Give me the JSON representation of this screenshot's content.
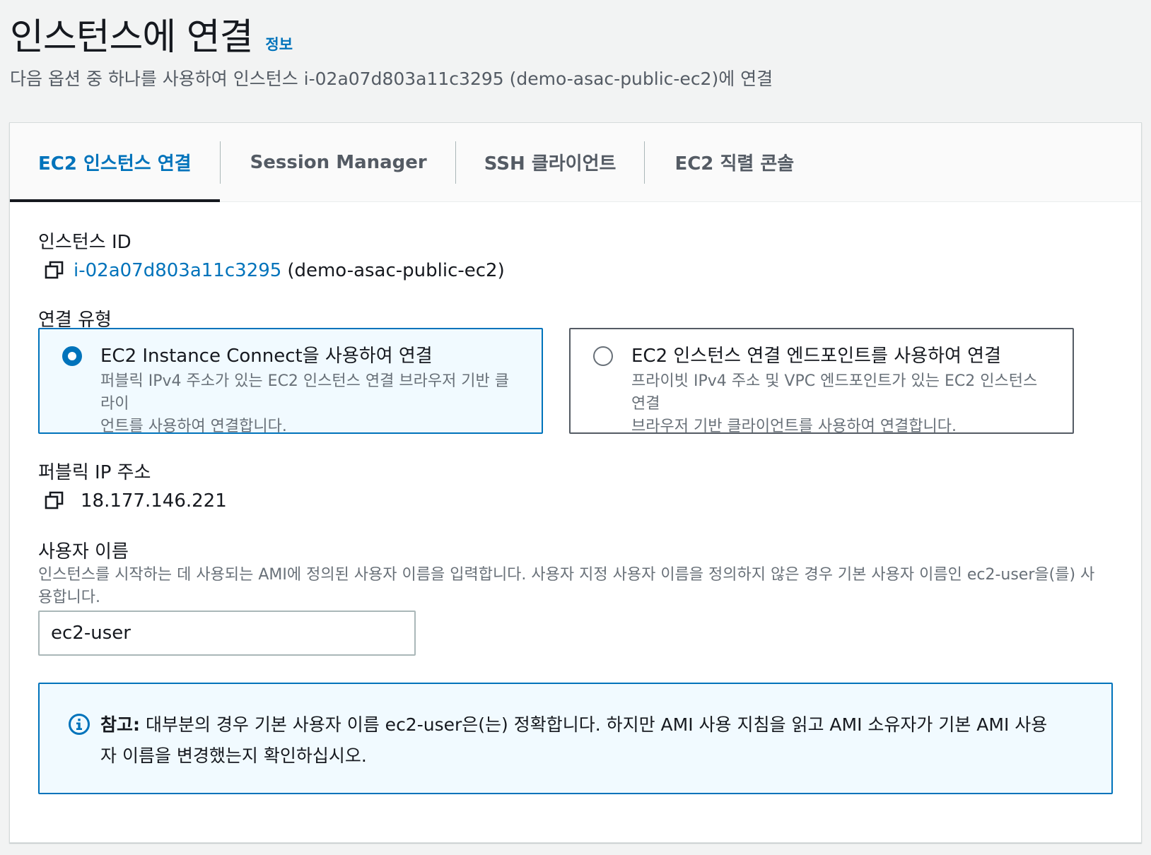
{
  "header": {
    "title": "인스턴스에 연결",
    "info_label": "정보",
    "subtitle": "다음 옵션 중 하나를 사용하여 인스턴스 i-02a07d803a11c3295 (demo-asac-public-ec2)에 연결"
  },
  "tabs": [
    {
      "label": "EC2 인스턴스 연결",
      "active": true
    },
    {
      "label": "Session Manager",
      "active": false
    },
    {
      "label": "SSH 클라이언트",
      "active": false
    },
    {
      "label": "EC2 직렬 콘솔",
      "active": false
    }
  ],
  "instance": {
    "label": "인스턴스 ID",
    "id": "i-02a07d803a11c3295",
    "name": "(demo-asac-public-ec2)"
  },
  "connection_type": {
    "label": "연결 유형",
    "options": [
      {
        "title": "EC2 Instance Connect을 사용하여 연결",
        "desc_line1": "퍼블릭 IPv4 주소가 있는 EC2 인스턴스 연결 브라우저 기반 클라이",
        "desc_line2": "언트를 사용하여 연결합니다.",
        "selected": true
      },
      {
        "title": "EC2 인스턴스 연결 엔드포인트를 사용하여 연결",
        "desc_line1": "프라이빗 IPv4 주소 및 VPC 엔드포인트가 있는 EC2 인스턴스 연결",
        "desc_line2": "브라우저 기반 클라이언트를 사용하여 연결합니다.",
        "selected": false
      }
    ]
  },
  "public_ip": {
    "label": "퍼블릭 IP 주소",
    "value": "18.177.146.221"
  },
  "username": {
    "label": "사용자 이름",
    "desc_line1": "인스턴스를 시작하는 데 사용되는 AMI에 정의된 사용자 이름을 입력합니다. 사용자 지정 사용자 이름을 정의하지 않은 경우 기본 사용자 이름인 ec2-user을(를) 사",
    "desc_line2": "용합니다.",
    "value": "ec2-user"
  },
  "note": {
    "prefix": "참고:",
    "line1": " 대부분의 경우 기본 사용자 이름 ec2-user은(는) 정확합니다. 하지만 AMI 사용 지침을 읽고 AMI 소유자가 기본 AMI 사용",
    "line2": "자 이름을 변경했는지 확인하십시오."
  },
  "colors": {
    "accent": "#0073bb",
    "text": "#16191f",
    "secondary_text": "#687078",
    "background": "#f2f3f3"
  },
  "icons": [
    "copy-icon",
    "info-circle-icon",
    "radio-checked",
    "radio-unchecked"
  ]
}
